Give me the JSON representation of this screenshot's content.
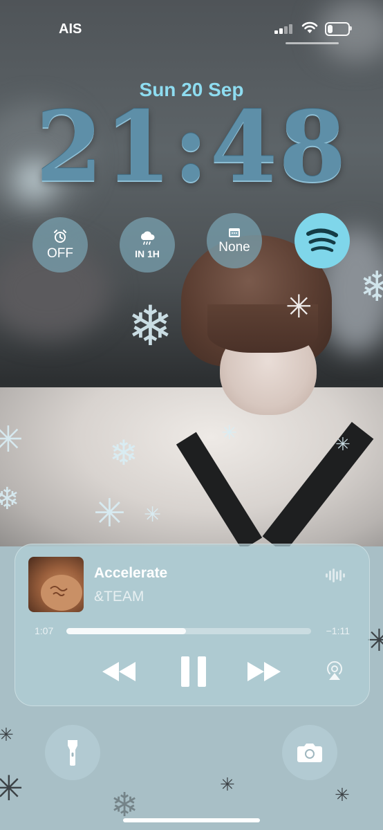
{
  "status_bar": {
    "carrier": "AIS",
    "signal_bars": 4,
    "battery_level": 0.3,
    "icons": [
      "cellular-signal-icon",
      "wifi-icon",
      "battery-icon"
    ]
  },
  "lock_screen": {
    "date": "Sun 20 Sep",
    "time": "21:48"
  },
  "widgets": [
    {
      "icon": "alarm-clock-icon",
      "label": "OFF"
    },
    {
      "icon": "rain-cloud-icon",
      "label": "IN 1H"
    },
    {
      "icon": "calendar-icon",
      "label": "None"
    },
    {
      "icon": "spotify-icon",
      "label": ""
    }
  ],
  "now_playing": {
    "track": "Accelerate",
    "artist": "&TEAM",
    "elapsed": "1:07",
    "remaining": "−1:11",
    "progress": 0.49,
    "icons": [
      "album-art",
      "audio-wave-icon",
      "rewind-icon",
      "pause-icon",
      "fast-forward-icon",
      "airplay-icon"
    ]
  },
  "quick_actions": {
    "left": "flashlight-icon",
    "right": "camera-icon"
  },
  "colors": {
    "accent_date": "#8edcf0",
    "clock": "#5e8fa8",
    "spotify_widget": "#7fd6ea"
  }
}
